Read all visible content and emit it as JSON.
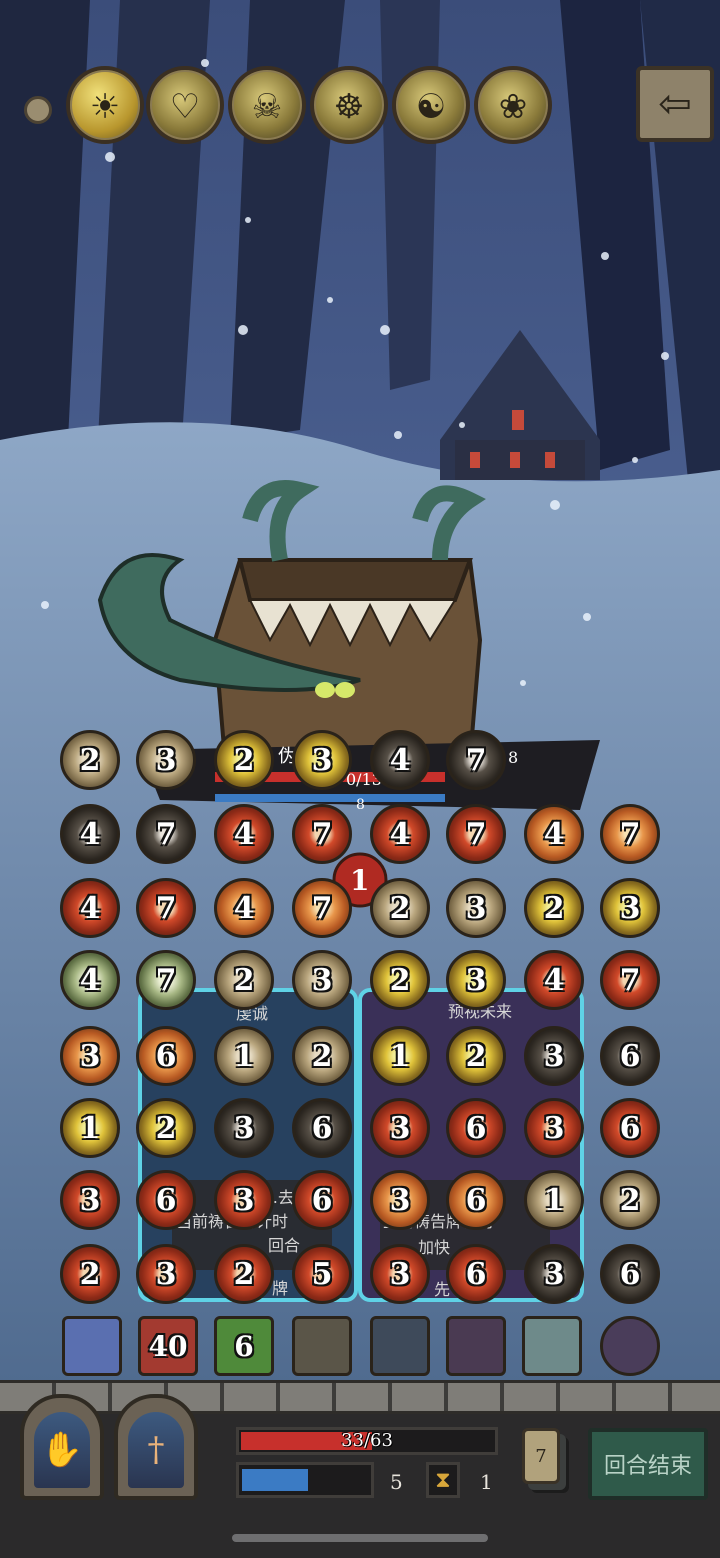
{
  "top_bar": {
    "menu_dot_icon": "dot-icon",
    "portraits": [
      {
        "icon": "golden-coin-portrait-icon"
      },
      {
        "icon": "angel-portrait-icon"
      },
      {
        "icon": "zombie-portrait-icon"
      },
      {
        "icon": "priest-portrait-icon"
      },
      {
        "icon": "monk-portrait-icon"
      },
      {
        "icon": "rose-portrait-icon"
      }
    ],
    "back_icon": "arrow-left-icon"
  },
  "enemy": {
    "name_partial": "伪装箱",
    "hp_partial": "0/13",
    "intent_value": "1",
    "side_value": "8",
    "bar_value": "8"
  },
  "cards": [
    {
      "title_partial": "虔诚",
      "text_line1": "…去",
      "text_line2": "当前祷告牌计时",
      "text_line3": "回合",
      "footer": "牌"
    },
    {
      "title_partial": "预视未来",
      "text_line1": "抽",
      "text_line2": "当前祷告牌计时",
      "text_line3": "加快",
      "footer": "先"
    }
  ],
  "coins": [
    [
      {
        "v": "2",
        "c": "tan"
      },
      {
        "v": "3",
        "c": "tan"
      },
      {
        "v": "2",
        "c": "gold"
      },
      {
        "v": "3",
        "c": "gold"
      },
      {
        "v": "4",
        "c": "dark"
      },
      {
        "v": "7",
        "c": "dark"
      }
    ],
    [
      {
        "v": "4",
        "c": "dark"
      },
      {
        "v": "7",
        "c": "dark"
      },
      {
        "v": "4",
        "c": "red"
      },
      {
        "v": "7",
        "c": "red"
      },
      {
        "v": "4",
        "c": "red"
      },
      {
        "v": "7",
        "c": "red"
      },
      {
        "v": "4",
        "c": "fire"
      },
      {
        "v": "7",
        "c": "fire"
      }
    ],
    [
      {
        "v": "4",
        "c": "red"
      },
      {
        "v": "7",
        "c": "red"
      },
      {
        "v": "4",
        "c": "fire"
      },
      {
        "v": "7",
        "c": "fire"
      },
      {
        "v": "2",
        "c": "tan"
      },
      {
        "v": "3",
        "c": "tan"
      },
      {
        "v": "2",
        "c": "gold"
      },
      {
        "v": "3",
        "c": "gold"
      }
    ],
    [
      {
        "v": "4",
        "c": "green"
      },
      {
        "v": "7",
        "c": "green"
      },
      {
        "v": "2",
        "c": "tan"
      },
      {
        "v": "3",
        "c": "tan"
      },
      {
        "v": "2",
        "c": "gold"
      },
      {
        "v": "3",
        "c": "gold"
      },
      {
        "v": "4",
        "c": "red"
      },
      {
        "v": "7",
        "c": "red"
      }
    ],
    [
      {
        "v": "3",
        "c": "fire"
      },
      {
        "v": "6",
        "c": "fire"
      },
      {
        "v": "1",
        "c": "tan"
      },
      {
        "v": "2",
        "c": "tan"
      },
      {
        "v": "1",
        "c": "gold"
      },
      {
        "v": "2",
        "c": "gold"
      },
      {
        "v": "3",
        "c": "dark"
      },
      {
        "v": "6",
        "c": "dark"
      }
    ],
    [
      {
        "v": "1",
        "c": "gold"
      },
      {
        "v": "2",
        "c": "gold"
      },
      {
        "v": "3",
        "c": "dark"
      },
      {
        "v": "6",
        "c": "dark"
      },
      {
        "v": "3",
        "c": "red"
      },
      {
        "v": "6",
        "c": "red"
      },
      {
        "v": "3",
        "c": "red"
      },
      {
        "v": "6",
        "c": "red"
      }
    ],
    [
      {
        "v": "3",
        "c": "red"
      },
      {
        "v": "6",
        "c": "red"
      },
      {
        "v": "3",
        "c": "red"
      },
      {
        "v": "6",
        "c": "red"
      },
      {
        "v": "3",
        "c": "fire"
      },
      {
        "v": "6",
        "c": "fire"
      },
      {
        "v": "1",
        "c": "tan"
      },
      {
        "v": "2",
        "c": "tan"
      }
    ],
    [
      {
        "v": "2",
        "c": "red"
      },
      {
        "v": "3",
        "c": "red"
      },
      {
        "v": "2",
        "c": "red"
      },
      {
        "v": "5",
        "c": "red"
      },
      {
        "v": "3",
        "c": "red"
      },
      {
        "v": "6",
        "c": "red"
      },
      {
        "v": "3",
        "c": "dark"
      },
      {
        "v": "6",
        "c": "dark"
      }
    ]
  ],
  "skills": [
    {
      "icon": "lightning-strike-icon",
      "value": "",
      "bg": "#5a6fb0"
    },
    {
      "icon": "mace-skill-icon",
      "value": "40",
      "bg": "#a33a30"
    },
    {
      "icon": "healing-circle-icon",
      "value": "6",
      "bg": "#4f8a3a"
    },
    {
      "icon": "priest-skill-icon",
      "value": "",
      "bg": "#5a5548"
    },
    {
      "icon": "holy-book-icon",
      "value": "",
      "bg": "#3e4a5a"
    },
    {
      "icon": "demon-skill-icon",
      "value": "",
      "bg": "#4a3a52"
    },
    {
      "icon": "moon-orb-icon",
      "value": "",
      "bg": "#6e8a8a"
    },
    {
      "icon": "purple-book-icon",
      "value": "",
      "bg": "#4a3d5a"
    }
  ],
  "player": {
    "hp_text": "33/63",
    "hp_fraction": 0.52,
    "mana_fraction": 0.52,
    "mana_value": "5",
    "timer_value": "1",
    "deck_count": "7",
    "end_turn_label": "回合结束",
    "shrines": [
      {
        "icon": "blessing-hand-icon"
      },
      {
        "icon": "dagger-hand-icon"
      }
    ]
  }
}
